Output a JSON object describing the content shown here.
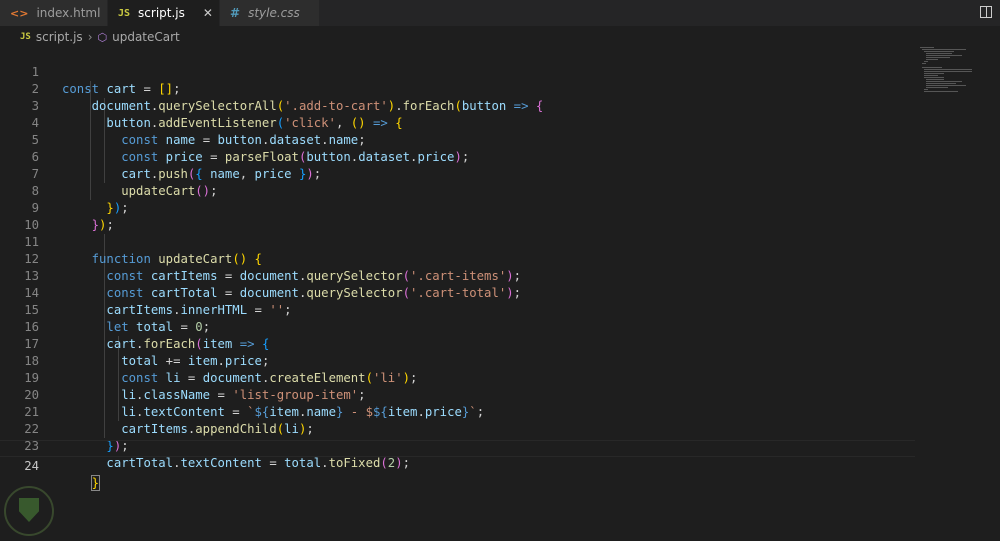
{
  "tabs": [
    {
      "label": "index.html",
      "icon": "html-file-icon",
      "active": false
    },
    {
      "label": "script.js",
      "icon": "js-file-icon",
      "active": true
    },
    {
      "label": "style.css",
      "icon": "css-file-icon",
      "active": false
    }
  ],
  "tab_icons": {
    "html": "<>",
    "js": "JS",
    "css": "#"
  },
  "breadcrumb": {
    "file": "script.js",
    "symbol": "updateCart",
    "js_badge": "JS"
  },
  "line_numbers": [
    "1",
    "2",
    "3",
    "4",
    "5",
    "6",
    "7",
    "8",
    "9",
    "10",
    "11",
    "12",
    "13",
    "14",
    "15",
    "16",
    "17",
    "18",
    "19",
    "20",
    "21",
    "22",
    "23",
    "24"
  ],
  "code": {
    "l1": [
      "const",
      "cart",
      "=",
      "[]",
      ";"
    ],
    "l2": [
      "document",
      ".",
      "querySelectorAll",
      "(",
      "'.add-to-cart'",
      ")",
      ".",
      "forEach",
      "(",
      "button",
      "=>",
      "{"
    ],
    "l3": [
      "button",
      ".",
      "addEventListener",
      "(",
      "'click'",
      ",",
      "()",
      "=>",
      "{"
    ],
    "l4": [
      "const",
      "name",
      "=",
      "button",
      ".",
      "dataset",
      ".",
      "name",
      ";"
    ],
    "l5": [
      "const",
      "price",
      "=",
      "parseFloat",
      "(",
      "button",
      ".",
      "dataset",
      ".",
      "price",
      ")",
      ";"
    ],
    "l6": [
      "cart",
      ".",
      "push",
      "(",
      "{",
      "name",
      ",",
      "price",
      "}",
      ")",
      ";"
    ],
    "l7": [
      "updateCart",
      "()",
      ";"
    ],
    "l8": [
      "}",
      ")",
      ";"
    ],
    "l9": [
      "}",
      ")",
      ";"
    ],
    "l11": [
      "function",
      "updateCart",
      "()",
      "{"
    ],
    "l12": [
      "const",
      "cartItems",
      "=",
      "document",
      ".",
      "querySelector",
      "(",
      "'.cart-items'",
      ")",
      ";"
    ],
    "l13": [
      "const",
      "cartTotal",
      "=",
      "document",
      ".",
      "querySelector",
      "(",
      "'.cart-total'",
      ")",
      ";"
    ],
    "l14": [
      "cartItems",
      ".",
      "innerHTML",
      "=",
      "''",
      ";"
    ],
    "l15": [
      "let",
      "total",
      "=",
      "0",
      ";"
    ],
    "l16": [
      "cart",
      ".",
      "forEach",
      "(",
      "item",
      "=>",
      "{"
    ],
    "l17": [
      "total",
      "+=",
      "item",
      ".",
      "price",
      ";"
    ],
    "l18": [
      "const",
      "li",
      "=",
      "document",
      ".",
      "createElement",
      "(",
      "'li'",
      ")",
      ";"
    ],
    "l19": [
      "li",
      ".",
      "className",
      "=",
      "'list-group-item'",
      ";"
    ],
    "l20": [
      "li",
      ".",
      "textContent",
      "=",
      "`",
      "${",
      "item",
      ".",
      "name",
      "}",
      " - $",
      "${",
      "item",
      ".",
      "price",
      "}",
      "`",
      ";"
    ],
    "l21": [
      "cartItems",
      ".",
      "appendChild",
      "(",
      "li",
      ")",
      ";"
    ],
    "l22": [
      "}",
      ")",
      ";"
    ],
    "l23": [
      "cartTotal",
      ".",
      "textContent",
      "=",
      "total",
      ".",
      "toFixed",
      "(",
      "2",
      ")",
      ";"
    ],
    "l24": [
      "}"
    ]
  },
  "current_line": "24",
  "colors": {
    "keyword": "#569cd6",
    "variable": "#9cdcfe",
    "function": "#dcdcaa",
    "string": "#ce9178",
    "number": "#b5cea8",
    "bracket1": "#ffd700",
    "bracket2": "#da70d6",
    "bracket3": "#179fff",
    "background": "#1e1e1e"
  }
}
